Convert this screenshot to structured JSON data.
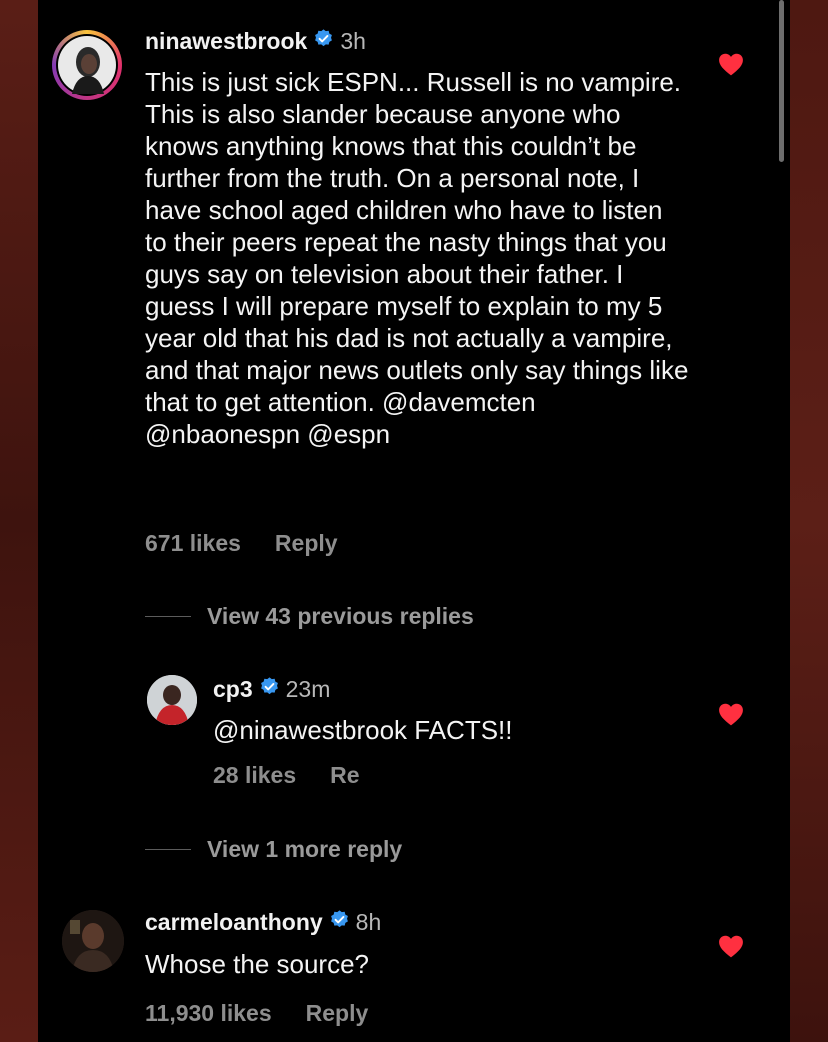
{
  "comments": [
    {
      "username": "ninawestbrook",
      "time": "3h",
      "text": "This is just sick ESPN... Russell is no vampire. This is also slander because anyone who knows anything knows that this couldn’t be further from the truth. On a personal note, I have school aged children who have to listen to their peers repeat the nasty things that you guys say on television about their father. I guess I will prepare myself to explain to my 5 year old that his dad is not actually a vampire, and that major news outlets only say things like that to get attention. @davemcten @nbaonespn @espn",
      "likes": "671 likes",
      "reply": "Reply",
      "verified": true
    },
    {
      "username": "cp3",
      "time": "23m",
      "text": "@ninawestbrook FACTS!!",
      "likes": "28 likes",
      "reply": "Re",
      "verified": true
    },
    {
      "username": "carmeloanthony",
      "time": "8h",
      "text": "Whose the source?",
      "likes": "11,930 likes",
      "reply": "Reply",
      "verified": true
    }
  ],
  "view_previous": "View 43 previous replies",
  "view_more": "View 1 more reply",
  "icons": {
    "verified": "verified-badge-icon",
    "like": "heart-icon"
  },
  "colors": {
    "background": "#000000",
    "verified": "#3897f0",
    "heart": "#ff3040",
    "muted": "#8e8e8e"
  }
}
